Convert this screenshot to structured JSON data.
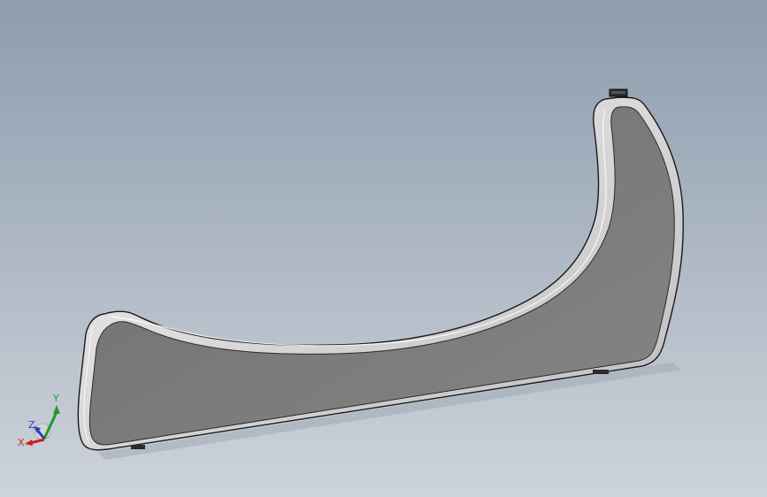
{
  "viewport": {
    "background_top": "#8e9cae",
    "background_bottom": "#cdd3da"
  },
  "part": {
    "face_color": "#7c7c7c",
    "rim_color": "#d9d9d9",
    "edge_color": "#1a1a1a"
  },
  "triad": {
    "x_label": "X",
    "y_label": "Y",
    "z_label": "Z",
    "x_color": "#cc2020",
    "y_color": "#1f9a2a",
    "z_color": "#2a3fbf"
  }
}
